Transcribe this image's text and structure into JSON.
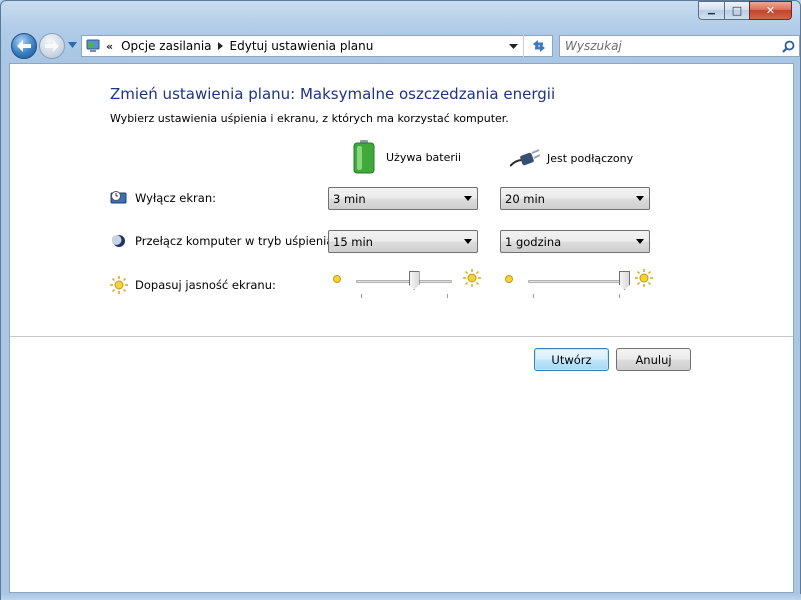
{
  "window": {
    "caption": {
      "minimize": "▁",
      "maximize": "□",
      "close": "✕"
    }
  },
  "nav": {
    "address": {
      "overflow": "«",
      "breadcrumbs": [
        "Opcje zasilania",
        "Edytuj ustawienia planu"
      ]
    },
    "search": {
      "placeholder": "Wyszukaj"
    }
  },
  "main": {
    "title": "Zmień ustawienia planu: Maksymalne oszczedzania energii",
    "subtitle": "Wybierz ustawienia uśpienia i ekranu, z których ma korzystać komputer.",
    "columns": {
      "battery": "Używa baterii",
      "plugged": "Jest podłączony"
    },
    "rows": {
      "display": {
        "label": "Wyłącz ekran:",
        "battery_value": "3 min",
        "plugged_value": "20 min"
      },
      "sleep": {
        "label": "Przełącz komputer w tryb uśpienia:",
        "battery_value": "15 min",
        "plugged_value": "1 godzina"
      },
      "brightness": {
        "label": "Dopasuj jasność ekranu:",
        "battery_level": 0.6,
        "plugged_level": 1.0
      }
    }
  },
  "buttons": {
    "create": "Utwórz",
    "cancel": "Anuluj"
  },
  "colors": {
    "title": "#1e3287",
    "frame": "#a9c6e4",
    "close": "#c2412a",
    "battery_green": "#3fa93a"
  }
}
